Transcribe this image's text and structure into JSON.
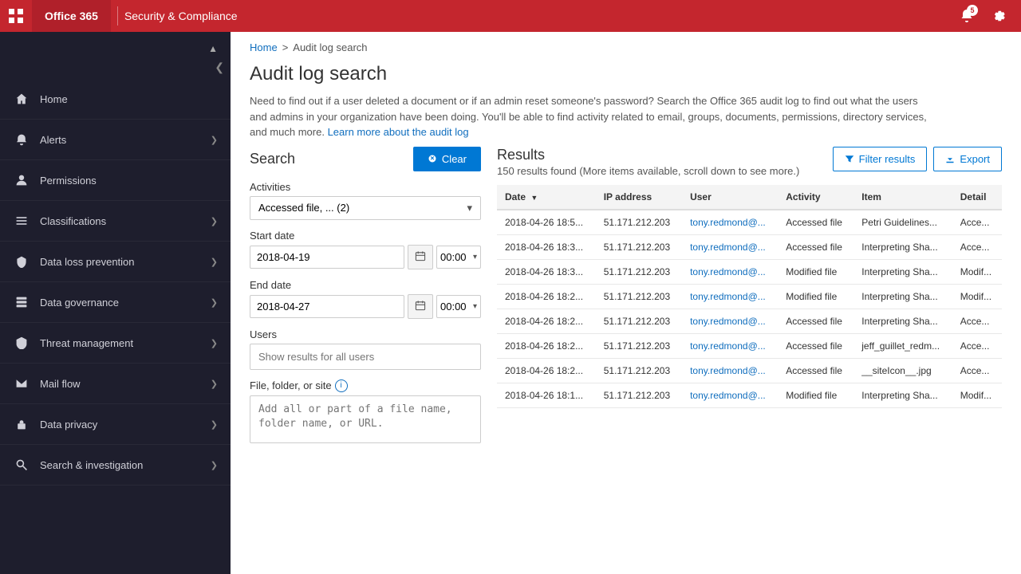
{
  "topbar": {
    "apps_label": "⊞",
    "office_label": "Office 365",
    "title": "Security & Compliance",
    "notifications_count": "5",
    "settings_label": "⚙"
  },
  "sidebar": {
    "collapse_label": "❮",
    "items": [
      {
        "id": "home",
        "icon": "🏠",
        "label": "Home",
        "arrow": ""
      },
      {
        "id": "alerts",
        "icon": "⚠",
        "label": "Alerts",
        "arrow": "❯"
      },
      {
        "id": "permissions",
        "icon": "👤",
        "label": "Permissions",
        "arrow": ""
      },
      {
        "id": "classifications",
        "icon": "≡",
        "label": "Classifications",
        "arrow": "❯"
      },
      {
        "id": "data-loss-prevention",
        "icon": "🛡",
        "label": "Data loss prevention",
        "arrow": "❯"
      },
      {
        "id": "data-governance",
        "icon": "📋",
        "label": "Data governance",
        "arrow": "❯"
      },
      {
        "id": "threat-management",
        "icon": "🔰",
        "label": "Threat management",
        "arrow": "❯"
      },
      {
        "id": "mail-flow",
        "icon": "✉",
        "label": "Mail flow",
        "arrow": "❯"
      },
      {
        "id": "data-privacy",
        "icon": "🔑",
        "label": "Data privacy",
        "arrow": "❯"
      },
      {
        "id": "search-investigation",
        "icon": "🔍",
        "label": "Search & investigation",
        "arrow": "❯"
      }
    ]
  },
  "breadcrumb": {
    "home": "Home",
    "separator": ">",
    "current": "Audit log search"
  },
  "page": {
    "title": "Audit log search",
    "description": "Need to find out if a user deleted a document or if an admin reset someone's password? Search the Office 365 audit log to find out what the users and admins in your organization have been doing. You'll be able to find activity related to email, groups, documents, permissions, directory services, and much more.",
    "learn_more": "Learn more about the audit log"
  },
  "search": {
    "title": "Search",
    "clear_label": "Clear",
    "activities_label": "Activities",
    "activities_value": "Accessed file, ... (2)",
    "start_date_label": "Start date",
    "start_date_value": "2018-04-19",
    "start_time_value": "00:00",
    "end_date_label": "End date",
    "end_date_value": "2018-04-27",
    "end_time_value": "00:00",
    "users_label": "Users",
    "users_placeholder": "Show results for all users",
    "file_label": "File, folder, or site",
    "file_placeholder": "Add all or part of a file name, folder name, or URL."
  },
  "results": {
    "title": "Results",
    "count_text": "150 results found (More items available, scroll down to see more.)",
    "filter_label": "Filter results",
    "export_label": "Export",
    "columns": [
      "Date",
      "IP address",
      "User",
      "Activity",
      "Item",
      "Detail"
    ],
    "rows": [
      {
        "date": "2018-04-26 18:5...",
        "ip": "51.171.212.203",
        "user": "tony.redmond@...",
        "activity": "Accessed file",
        "item": "Petri Guidelines...",
        "detail": "Acce..."
      },
      {
        "date": "2018-04-26 18:3...",
        "ip": "51.171.212.203",
        "user": "tony.redmond@...",
        "activity": "Accessed file",
        "item": "Interpreting Sha...",
        "detail": "Acce..."
      },
      {
        "date": "2018-04-26 18:3...",
        "ip": "51.171.212.203",
        "user": "tony.redmond@...",
        "activity": "Modified file",
        "item": "Interpreting Sha...",
        "detail": "Modif..."
      },
      {
        "date": "2018-04-26 18:2...",
        "ip": "51.171.212.203",
        "user": "tony.redmond@...",
        "activity": "Modified file",
        "item": "Interpreting Sha...",
        "detail": "Modif..."
      },
      {
        "date": "2018-04-26 18:2...",
        "ip": "51.171.212.203",
        "user": "tony.redmond@...",
        "activity": "Accessed file",
        "item": "Interpreting Sha...",
        "detail": "Acce..."
      },
      {
        "date": "2018-04-26 18:2...",
        "ip": "51.171.212.203",
        "user": "tony.redmond@...",
        "activity": "Accessed file",
        "item": "jeff_guillet_redm...",
        "detail": "Acce..."
      },
      {
        "date": "2018-04-26 18:2...",
        "ip": "51.171.212.203",
        "user": "tony.redmond@...",
        "activity": "Accessed file",
        "item": "__siteIcon__.jpg",
        "detail": "Acce..."
      },
      {
        "date": "2018-04-26 18:1...",
        "ip": "51.171.212.203",
        "user": "tony.redmond@...",
        "activity": "Modified file",
        "item": "Interpreting Sha...",
        "detail": "Modif..."
      }
    ]
  }
}
